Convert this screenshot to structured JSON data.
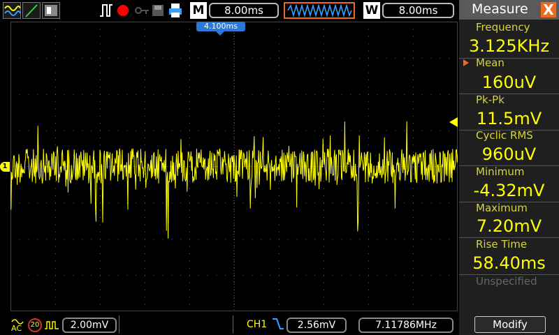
{
  "topbar": {
    "timebase": "8.00ms",
    "m_label": "M",
    "w_label": "W",
    "window_timebase": "8.00ms"
  },
  "trigger_marker": "4.100ms",
  "channel_marker": "1",
  "bottombar": {
    "coupling_label": "AC",
    "bw_label": "20",
    "volts_div": "2.00mV",
    "trig_channel": "CH1",
    "trig_level": "2.56mV",
    "frequency": "7.11786MHz"
  },
  "measure": {
    "title": "Measure",
    "close": "X",
    "items": [
      {
        "label": "Frequency",
        "value": "3.125KHz"
      },
      {
        "label": "Mean",
        "value": "160uV"
      },
      {
        "label": "Pk-Pk",
        "value": "11.5mV"
      },
      {
        "label": "Cyclic RMS",
        "value": "960uV"
      },
      {
        "label": "Minimum",
        "value": "-4.32mV"
      },
      {
        "label": "Maximum",
        "value": "7.20mV"
      },
      {
        "label": "Rise Time",
        "value": "58.40ms"
      }
    ],
    "unspecified": "Unspecified",
    "modify": "Modify"
  },
  "colors": {
    "trace": "#ffff00",
    "grid": "#6a6a6a",
    "accent": "#f06a1e",
    "marker": "#2a78d8"
  }
}
